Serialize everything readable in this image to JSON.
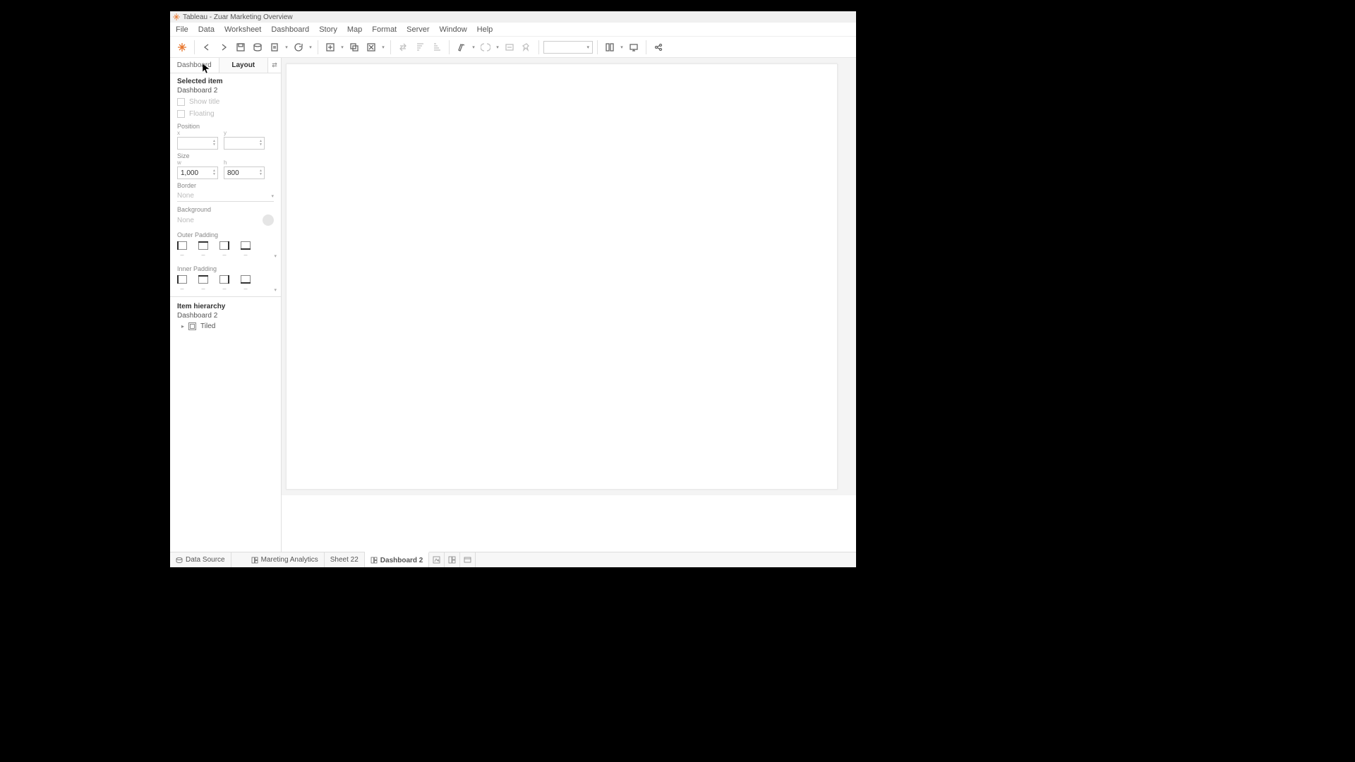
{
  "window": {
    "title": "Tableau - Zuar Marketing Overview"
  },
  "menu": {
    "items": [
      "File",
      "Data",
      "Worksheet",
      "Dashboard",
      "Story",
      "Map",
      "Format",
      "Server",
      "Window",
      "Help"
    ]
  },
  "panel": {
    "tabs": {
      "dashboard": "Dashboard",
      "layout": "Layout"
    },
    "selected_header": "Selected item",
    "selected_value": "Dashboard 2",
    "show_title_label": "Show title",
    "floating_label": "Floating",
    "position_label": "Position",
    "x_label": "x",
    "y_label": "y",
    "x_value": "",
    "y_value": "",
    "size_label": "Size",
    "w_label": "w",
    "h_label": "h",
    "w_value": "1,000",
    "h_value": "800",
    "border_label": "Border",
    "border_value": "None",
    "background_label": "Background",
    "background_value": "None",
    "outer_padding_label": "Outer Padding",
    "inner_padding_label": "Inner Padding",
    "pad_dash": "–",
    "hierarchy_header": "Item hierarchy",
    "hierarchy_value": "Dashboard 2",
    "tree_item": "Tiled"
  },
  "bottom": {
    "data_source": "Data Source",
    "tabs": [
      {
        "label": "Mareting Analytics",
        "type": "dashboard"
      },
      {
        "label": "Sheet 22",
        "type": "sheet"
      },
      {
        "label": "Dashboard 2",
        "type": "dashboard",
        "active": true
      }
    ]
  }
}
